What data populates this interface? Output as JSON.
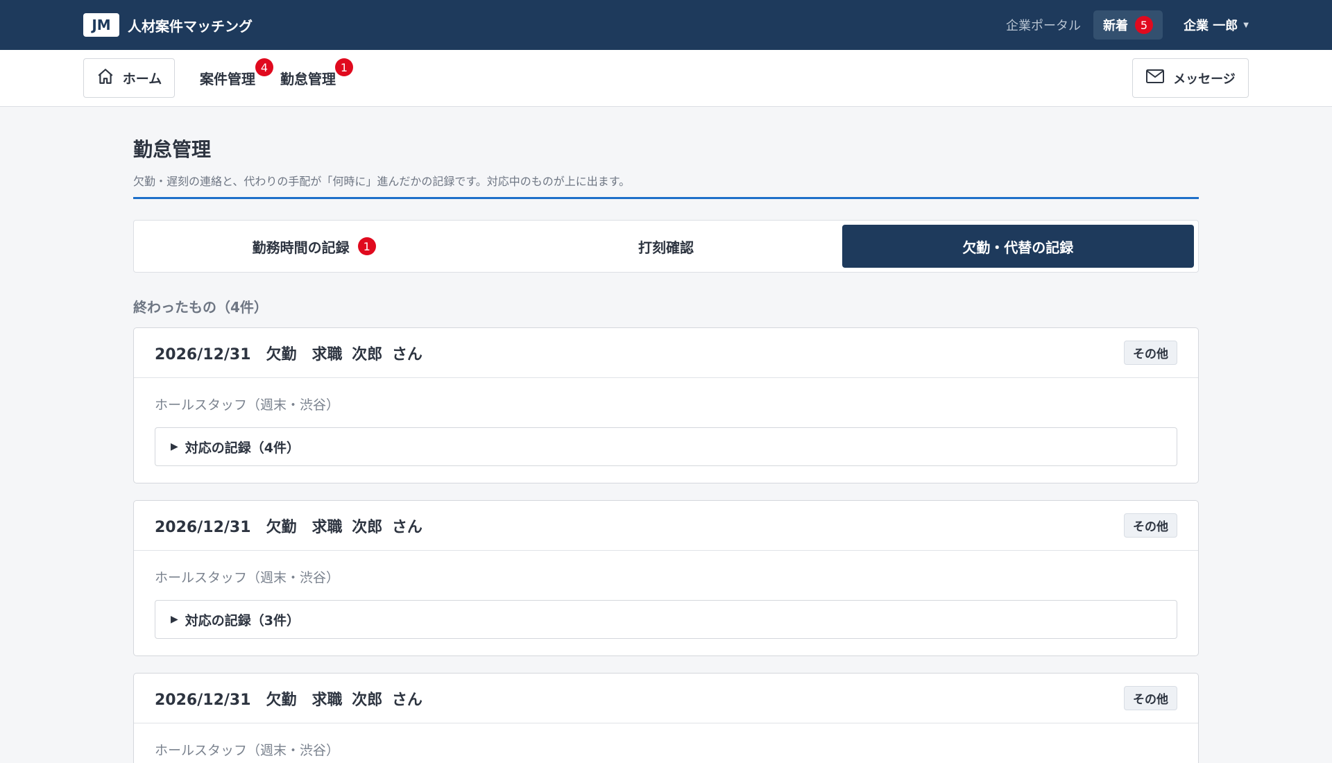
{
  "header": {
    "logo": "JM",
    "app_name": "人材案件マッチング",
    "portal_label": "企業ポータル",
    "news_label": "新着",
    "news_count": "5",
    "user_name": "企業 一郎"
  },
  "nav": {
    "home_label": "ホーム",
    "items": [
      {
        "label": "案件管理",
        "badge": "4"
      },
      {
        "label": "勤怠管理",
        "badge": "1"
      }
    ],
    "message_label": "メッセージ"
  },
  "page": {
    "title": "勤怠管理",
    "description": "欠勤・遅刻の連絡と、代わりの手配が「何時に」進んだかの記録です。対応中のものが上に出ます。"
  },
  "tabs": [
    {
      "label": "勤務時間の記録",
      "badge": "1"
    },
    {
      "label": "打刻確認"
    },
    {
      "label": "欠勤・代替の記録",
      "active": true
    }
  ],
  "section": {
    "label": "終わったもの（4件）"
  },
  "records": [
    {
      "title": "2026/12/31　欠勤　求職 次郎 さん",
      "tag": "その他",
      "role": "ホールスタッフ（週末・渋谷）",
      "log_label": "対応の記録（4件）"
    },
    {
      "title": "2026/12/31　欠勤　求職 次郎 さん",
      "tag": "その他",
      "role": "ホールスタッフ（週末・渋谷）",
      "log_label": "対応の記録（3件）"
    },
    {
      "title": "2026/12/31　欠勤　求職 次郎 さん",
      "tag": "その他",
      "role": "ホールスタッフ（週末・渋谷）",
      "log_label": ""
    }
  ],
  "icons": {
    "home": "home-icon",
    "mail": "mail-icon",
    "disclosure": "triangle-right-icon"
  },
  "colors": {
    "header_bg": "#1e3a5c",
    "badge": "#e00a1e",
    "accent_line": "#1d6fc9"
  }
}
